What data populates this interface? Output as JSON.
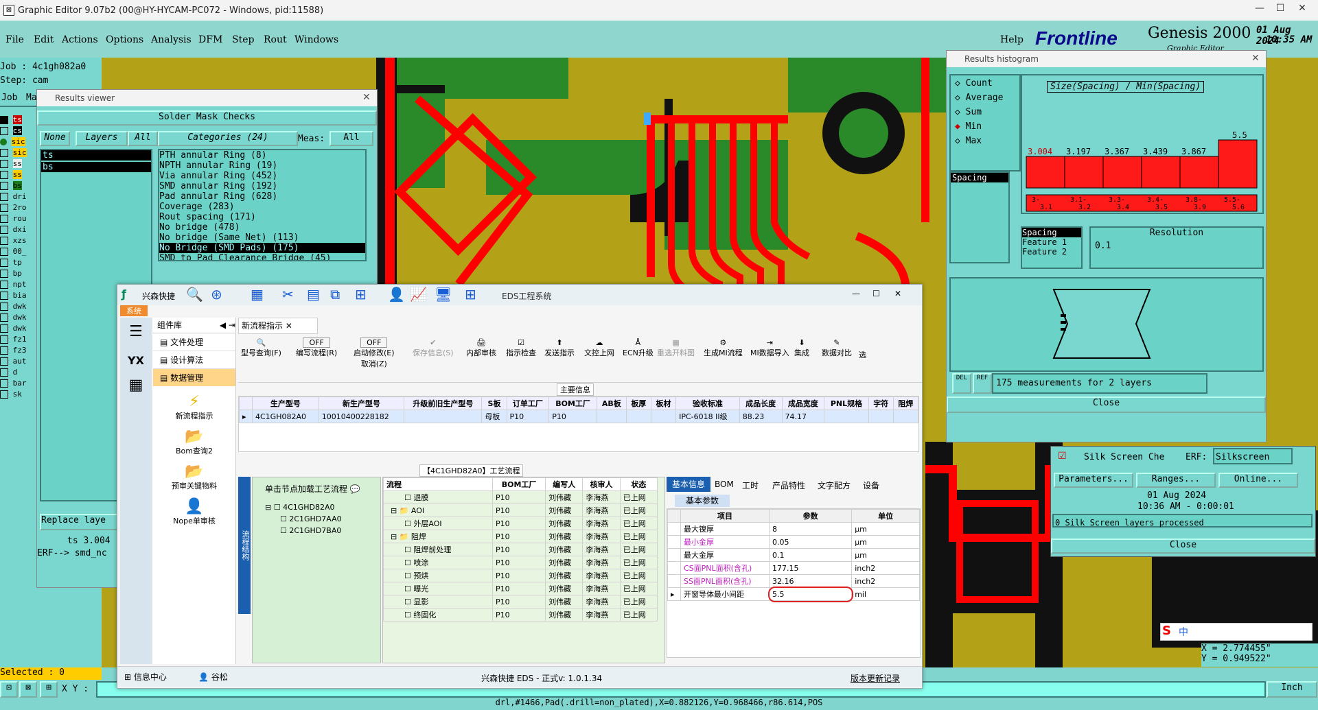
{
  "window": {
    "title": "Graphic Editor 9.07b2 (00@HY-HYCAM-PC072 - Windows, pid:11588)"
  },
  "menu": [
    "File",
    "Edit",
    "Actions",
    "Options",
    "Analysis",
    "DFM",
    "Step",
    "Rout",
    "Windows"
  ],
  "help": "Help",
  "brand": {
    "frontline": "Frontline",
    "genesis": "Genesis 2000",
    "subtitle": "Graphic Editor",
    "date": "01 Aug 2024",
    "time": "10:35 AM"
  },
  "job": {
    "job": "Job : 4c1gh082a0",
    "step": "Step: cam"
  },
  "left_tabs": {
    "job": "Job",
    "ma": "Ma"
  },
  "layers": [
    "ts",
    "cs",
    "sic",
    "sic",
    "ss",
    "ss",
    "bs",
    "dri",
    "2ro",
    "rou",
    "dxi",
    "xzs",
    "00_",
    "tp",
    "bp",
    "npt",
    "bia",
    "dwk",
    "dwk",
    "dwk",
    "fz1",
    "fz3",
    "aut",
    "d",
    "bar",
    "sk"
  ],
  "results_viewer": {
    "title": "Results viewer",
    "header": "Solder Mask Checks",
    "none": "None",
    "layers": "Layers",
    "all": "All",
    "categories": "Categories (24)",
    "meas": "Meas:",
    "meas_val": "All",
    "layer_items": [
      "ts",
      "bs"
    ],
    "categories_list": [
      "PTH annular Ring (8)",
      "NPTH annular Ring (19)",
      "Via annular Ring (452)",
      "SMD annular Ring (192)",
      "Pad annular Ring (628)",
      "Coverage (283)",
      "Rout spacing (171)",
      "No bridge (478)",
      "No bridge (Same Net) (113)",
      "No Bridge (SMD Pads) (175)",
      "SMD to Pad Clearance Bridge (45)"
    ],
    "replace": "Replace laye",
    "ts_line": "ts 3.004",
    "erf_line": "ERF--> smd_nc"
  },
  "histogram": {
    "title": "Results histogram",
    "options": [
      "Count",
      "Average",
      "Sum",
      "Min",
      "Max"
    ],
    "chart_title": "Size(Spacing) / Min(Spacing)",
    "bar_labels": [
      "3.004",
      "3.197",
      "3.367",
      "3.439",
      "3.867",
      "5.5"
    ],
    "ranges_top": [
      "3-",
      "3.1-",
      "3.3-",
      "3.4-",
      "3.8-",
      "5.5-"
    ],
    "ranges_bot": [
      "3.1",
      "3.2",
      "3.4",
      "3.5",
      "3.9",
      "5.6"
    ],
    "spacing": "Spacing",
    "feature_list": [
      "Spacing",
      "Feature 1",
      "Feature 2"
    ],
    "resolution": "Resolution",
    "resolution_val": "0.1",
    "del": "DEL",
    "ref": "REF",
    "measurements": "175 measurements for 2 layers",
    "close": "Close"
  },
  "silk": {
    "name": "Silk Screen Che",
    "erf": "ERF:",
    "erf_val": "Silkscreen",
    "params": "Parameters...",
    "ranges": "Ranges...",
    "online": "Online...",
    "date": "01 Aug 2024",
    "time": "10:36 AM - 0:00:01",
    "status": "0 Silk Screen layers processed",
    "close": "Close"
  },
  "coords": {
    "x": "X = 2.774455\"",
    "y": "Y = 0.949522\"",
    "units": "Inch"
  },
  "status": {
    "selected": "Selected : 0",
    "xy": "X Y :",
    "bottom": "drl,#1466,Pad(.drill=non_plated),X=0.882126,Y=0.968466,r86.614,POS"
  },
  "ime": {
    "lang": "中"
  },
  "eds": {
    "title": "EDS工程系统",
    "brand": "兴森快捷",
    "system": "系统",
    "sidebar_title": "组件库",
    "sidebar_items": [
      "文件处理",
      "设计算法",
      "数据管理"
    ],
    "sidebar_tools": [
      "新流程指示",
      "Bom查询2",
      "预审关键物料",
      "Nope单审核"
    ],
    "tab": "新流程指示",
    "toolbar": [
      "型号查询(F)",
      "编写流程(R)",
      "启动修改(E)",
      "保存信息(S)",
      "内部审核",
      "指示检查",
      "发送指示",
      "文控上网",
      "ECN升级",
      "重选开料图",
      "生成MI流程",
      "MI数据导入",
      "集成",
      "数据对比",
      "选"
    ],
    "toolbar_sub": [
      "OFF",
      "OFF",
      "取消(Z)"
    ],
    "main_info": "主要信息",
    "main_headers": [
      "生产型号",
      "新生产型号",
      "升级前旧生产型号",
      "S板",
      "订单工厂",
      "BOM工厂",
      "AB板",
      "板厚",
      "板材",
      "验收标准",
      "成品长度",
      "成品宽度",
      "PNL规格",
      "字符",
      "阻焊"
    ],
    "main_row": [
      "4C1GH082A0",
      "10010400228182",
      "",
      "母板",
      "P10",
      "P10",
      "",
      "",
      "",
      "IPC-6018 II级",
      "88.23",
      "74.17",
      "",
      "",
      ""
    ],
    "process_title": "【4C1GHD82A0】工艺流程",
    "vertical_label": "流程结构",
    "tree_hint": "单击节点加载工艺流程",
    "tree_root": "4C1GHD82A0",
    "tree_children": [
      "2C1GHD7AA0",
      "2C1GHD7BA0"
    ],
    "flow_headers": [
      "流程",
      "BOM工厂",
      "编写人",
      "核审人",
      "状态"
    ],
    "flow_rows": [
      {
        "name": "退膜",
        "bom": "P10",
        "writer": "刘伟藏",
        "reviewer": "李海燕",
        "status": "已上网"
      },
      {
        "name": "AOI",
        "bom": "P10",
        "writer": "刘伟藏",
        "reviewer": "李海燕",
        "status": "已上网"
      },
      {
        "name": "外层AOI",
        "bom": "P10",
        "writer": "刘伟藏",
        "reviewer": "李海燕",
        "status": "已上网"
      },
      {
        "name": "阻焊",
        "bom": "P10",
        "writer": "刘伟藏",
        "reviewer": "李海燕",
        "status": "已上网"
      },
      {
        "name": "阻焊前处理",
        "bom": "P10",
        "writer": "刘伟藏",
        "reviewer": "李海燕",
        "status": "已上网"
      },
      {
        "name": "喷涂",
        "bom": "P10",
        "writer": "刘伟藏",
        "reviewer": "李海燕",
        "status": "已上网"
      },
      {
        "name": "预烘",
        "bom": "P10",
        "writer": "刘伟藏",
        "reviewer": "李海燕",
        "status": "已上网"
      },
      {
        "name": "曝光",
        "bom": "P10",
        "writer": "刘伟藏",
        "reviewer": "李海燕",
        "status": "已上网"
      },
      {
        "name": "显影",
        "bom": "P10",
        "writer": "刘伟藏",
        "reviewer": "李海燕",
        "status": "已上网"
      },
      {
        "name": "终固化",
        "bom": "P10",
        "writer": "刘伟藏",
        "reviewer": "李海燕",
        "status": "已上网"
      }
    ],
    "info_tabs": [
      "基本信息",
      "BOM",
      "工时",
      "产品特性",
      "文字配方",
      "设备"
    ],
    "basic_params": "基本参数",
    "param_headers": [
      "项目",
      "参数",
      "单位"
    ],
    "param_rows": [
      {
        "item": "最大镍厚",
        "value": "8",
        "unit": "μm",
        "hl": false
      },
      {
        "item": "最小金厚",
        "value": "0.05",
        "unit": "μm",
        "hl": true
      },
      {
        "item": "最大金厚",
        "value": "0.1",
        "unit": "μm",
        "hl": false
      },
      {
        "item": "CS面PNL面积(含孔)",
        "value": "177.15",
        "unit": "inch2",
        "hl": true
      },
      {
        "item": "SS面PNL面积(含孔)",
        "value": "32.16",
        "unit": "inch2",
        "hl": true
      },
      {
        "item": "开窗导体最小间距",
        "value": "5.5",
        "unit": "mil",
        "hl": false
      }
    ],
    "footer_left": "信息中心",
    "footer_user": "谷松",
    "footer_mid": "兴森快捷 EDS - 正式v: 1.0.1.34",
    "footer_right": "版本更新记录"
  }
}
